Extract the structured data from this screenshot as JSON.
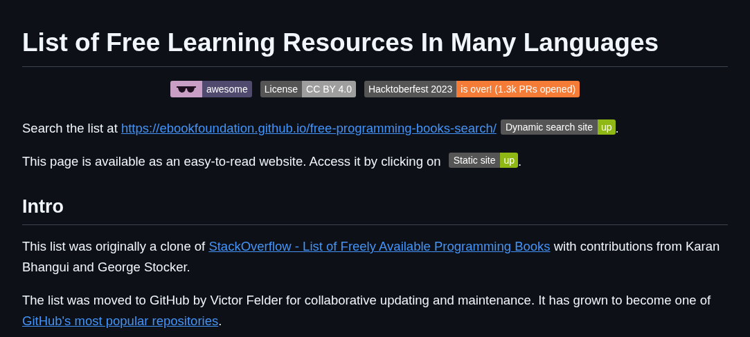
{
  "title": "List of Free Learning Resources In Many Languages",
  "badges": [
    {
      "kind": "icon",
      "message": "awesome",
      "color": "#4f4a6e"
    },
    {
      "kind": "text",
      "label": "License",
      "message": "CC BY 4.0",
      "color": "#9e9e9e"
    },
    {
      "kind": "text",
      "label": "Hacktoberfest 2023",
      "message": "is over! (1.3k PRs opened)",
      "color": "#f47c36"
    }
  ],
  "intro_paragraphs": [
    {
      "segments": [
        {
          "kind": "text",
          "text": "Search the list at "
        },
        {
          "kind": "link",
          "text": "https://ebookfoundation.github.io/free-programming-books-search/"
        },
        {
          "kind": "badge",
          "label": "Dynamic search site",
          "message": "up",
          "color": "#8fb814"
        },
        {
          "kind": "text",
          "text": "."
        }
      ]
    },
    {
      "segments": [
        {
          "kind": "text",
          "text": "This page is available as an easy-to-read website. Access it by clicking on "
        },
        {
          "kind": "badge",
          "label": "Static site",
          "message": "up",
          "color": "#8fb814"
        },
        {
          "kind": "text",
          "text": "."
        }
      ]
    }
  ],
  "section": {
    "heading": "Intro",
    "paragraphs": [
      {
        "segments": [
          {
            "kind": "text",
            "text": "This list was originally a clone of "
          },
          {
            "kind": "link",
            "text": "StackOverflow - List of Freely Available Programming Books"
          },
          {
            "kind": "text",
            "text": " with contributions from Karan Bhangui and George Stocker."
          }
        ]
      },
      {
        "segments": [
          {
            "kind": "text",
            "text": "The list was moved to GitHub by Victor Felder for collaborative updating and maintenance. It has grown to become one of "
          },
          {
            "kind": "link",
            "text": "GitHub's most popular repositories"
          },
          {
            "kind": "text",
            "text": "."
          }
        ]
      }
    ]
  }
}
